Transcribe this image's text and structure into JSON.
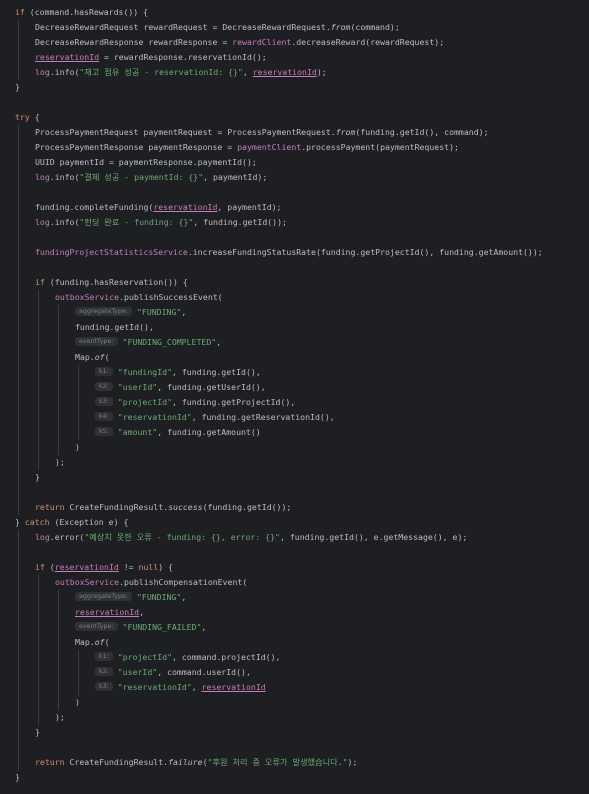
{
  "code": {
    "lines": [
      {
        "indent": 0,
        "tokens": [
          {
            "t": "if",
            "c": "kw"
          },
          {
            "t": " (command.hasRewards()) {"
          }
        ]
      },
      {
        "indent": 1,
        "tokens": [
          {
            "t": "DecreaseRewardRequest rewardRequest = DecreaseRewardRequest."
          },
          {
            "t": "from",
            "c": "it"
          },
          {
            "t": "(command);"
          }
        ]
      },
      {
        "indent": 1,
        "tokens": [
          {
            "t": "DecreaseRewardResponse rewardResponse = "
          },
          {
            "t": "rewardClient",
            "c": "fld"
          },
          {
            "t": ".decreaseReward(rewardRequest);"
          }
        ]
      },
      {
        "indent": 1,
        "tokens": [
          {
            "t": "reservationId",
            "c": "fld u"
          },
          {
            "t": " = rewardResponse.reservationId();"
          }
        ]
      },
      {
        "indent": 1,
        "tokens": [
          {
            "t": "log",
            "c": "fld"
          },
          {
            "t": ".info("
          },
          {
            "t": "\"재고 점유 성공 - reservationId: {}\"",
            "c": "str"
          },
          {
            "t": ", "
          },
          {
            "t": "reservationId",
            "c": "fld u"
          },
          {
            "t": ");"
          }
        ]
      },
      {
        "indent": 0,
        "tokens": [
          {
            "t": "}"
          }
        ]
      },
      {
        "indent": 0,
        "tokens": []
      },
      {
        "indent": 0,
        "tokens": [
          {
            "t": "try",
            "c": "kw"
          },
          {
            "t": " {"
          }
        ]
      },
      {
        "indent": 1,
        "tokens": [
          {
            "t": "ProcessPaymentRequest paymentRequest = ProcessPaymentRequest."
          },
          {
            "t": "from",
            "c": "it"
          },
          {
            "t": "(funding.getId(), command);"
          }
        ]
      },
      {
        "indent": 1,
        "tokens": [
          {
            "t": "ProcessPaymentResponse paymentResponse = "
          },
          {
            "t": "paymentClient",
            "c": "fld"
          },
          {
            "t": ".processPayment(paymentRequest);"
          }
        ]
      },
      {
        "indent": 1,
        "tokens": [
          {
            "t": "UUID paymentId = paymentResponse.paymentId();"
          }
        ]
      },
      {
        "indent": 1,
        "tokens": [
          {
            "t": "log",
            "c": "fld"
          },
          {
            "t": ".info("
          },
          {
            "t": "\"결제 성공 - paymentId: {}\"",
            "c": "str"
          },
          {
            "t": ", paymentId);"
          }
        ]
      },
      {
        "indent": 0,
        "tokens": []
      },
      {
        "indent": 1,
        "tokens": [
          {
            "t": "funding.completeFunding("
          },
          {
            "t": "reservationId",
            "c": "fld u"
          },
          {
            "t": ", paymentId);"
          }
        ]
      },
      {
        "indent": 1,
        "tokens": [
          {
            "t": "log",
            "c": "fld"
          },
          {
            "t": ".info("
          },
          {
            "t": "\"펀딩 완료 - funding: {}\"",
            "c": "str"
          },
          {
            "t": ", funding.getId());"
          }
        ]
      },
      {
        "indent": 0,
        "tokens": []
      },
      {
        "indent": 1,
        "tokens": [
          {
            "t": "fundingProjectStatisticsService",
            "c": "fld"
          },
          {
            "t": ".increaseFundingStatusRate(funding.getProjectId(), funding.getAmount());"
          }
        ]
      },
      {
        "indent": 0,
        "tokens": []
      },
      {
        "indent": 1,
        "tokens": [
          {
            "t": "if",
            "c": "kw"
          },
          {
            "t": " (funding.hasReservation()) {"
          }
        ]
      },
      {
        "indent": 2,
        "tokens": [
          {
            "t": "outboxService",
            "c": "fld"
          },
          {
            "t": ".publishSuccessEvent("
          }
        ]
      },
      {
        "indent": 3,
        "tokens": [
          {
            "t": "aggregateType:",
            "c": "hint"
          },
          {
            "t": "\"FUNDING\"",
            "c": "str"
          },
          {
            "t": ","
          }
        ]
      },
      {
        "indent": 3,
        "tokens": [
          {
            "t": "funding.getId(),"
          }
        ]
      },
      {
        "indent": 3,
        "tokens": [
          {
            "t": "eventType:",
            "c": "hint"
          },
          {
            "t": "\"FUNDING_COMPLETED\"",
            "c": "str"
          },
          {
            "t": ","
          }
        ]
      },
      {
        "indent": 3,
        "tokens": [
          {
            "t": "Map."
          },
          {
            "t": "of",
            "c": "it"
          },
          {
            "t": "("
          }
        ]
      },
      {
        "indent": 4,
        "tokens": [
          {
            "t": "k1:",
            "c": "hint"
          },
          {
            "t": "\"fundingId\"",
            "c": "str"
          },
          {
            "t": ", funding.getId(),"
          }
        ]
      },
      {
        "indent": 4,
        "tokens": [
          {
            "t": "k2:",
            "c": "hint"
          },
          {
            "t": "\"userId\"",
            "c": "str"
          },
          {
            "t": ", funding.getUserId(),"
          }
        ]
      },
      {
        "indent": 4,
        "tokens": [
          {
            "t": "k3:",
            "c": "hint"
          },
          {
            "t": "\"projectId\"",
            "c": "str"
          },
          {
            "t": ", funding.getProjectId(),"
          }
        ]
      },
      {
        "indent": 4,
        "tokens": [
          {
            "t": "k4:",
            "c": "hint"
          },
          {
            "t": "\"reservationId\"",
            "c": "str"
          },
          {
            "t": ", funding.getReservationId(),"
          }
        ]
      },
      {
        "indent": 4,
        "tokens": [
          {
            "t": "k5:",
            "c": "hint"
          },
          {
            "t": "\"amount\"",
            "c": "str"
          },
          {
            "t": ", funding.getAmount()"
          }
        ]
      },
      {
        "indent": 3,
        "tokens": [
          {
            "t": ")"
          }
        ]
      },
      {
        "indent": 2,
        "tokens": [
          {
            "t": ");"
          }
        ]
      },
      {
        "indent": 1,
        "tokens": [
          {
            "t": "}"
          }
        ]
      },
      {
        "indent": 0,
        "tokens": []
      },
      {
        "indent": 1,
        "tokens": [
          {
            "t": "return",
            "c": "kw"
          },
          {
            "t": " CreateFundingResult."
          },
          {
            "t": "success",
            "c": "it"
          },
          {
            "t": "(funding.getId());"
          }
        ]
      },
      {
        "indent": 0,
        "tokens": [
          {
            "t": "} "
          },
          {
            "t": "catch",
            "c": "kw"
          },
          {
            "t": " (Exception e) {"
          }
        ]
      },
      {
        "indent": 1,
        "tokens": [
          {
            "t": "log",
            "c": "fld"
          },
          {
            "t": ".error("
          },
          {
            "t": "\"예상치 못한 오류 - funding: {}, error: {}\"",
            "c": "str"
          },
          {
            "t": ", funding.getId(), e.getMessage(), e);"
          }
        ]
      },
      {
        "indent": 0,
        "tokens": []
      },
      {
        "indent": 1,
        "tokens": [
          {
            "t": "if",
            "c": "kw"
          },
          {
            "t": " ("
          },
          {
            "t": "reservationId",
            "c": "fld u"
          },
          {
            "t": " != "
          },
          {
            "t": "null",
            "c": "kw"
          },
          {
            "t": ") {"
          }
        ]
      },
      {
        "indent": 2,
        "tokens": [
          {
            "t": "outboxService",
            "c": "fld"
          },
          {
            "t": ".publishCompensationEvent("
          }
        ]
      },
      {
        "indent": 3,
        "tokens": [
          {
            "t": "aggregateType:",
            "c": "hint"
          },
          {
            "t": "\"FUNDING\"",
            "c": "str"
          },
          {
            "t": ","
          }
        ]
      },
      {
        "indent": 3,
        "tokens": [
          {
            "t": "reservationId",
            "c": "fld u"
          },
          {
            "t": ","
          }
        ]
      },
      {
        "indent": 3,
        "tokens": [
          {
            "t": "eventType:",
            "c": "hint"
          },
          {
            "t": "\"FUNDING_FAILED\"",
            "c": "str"
          },
          {
            "t": ","
          }
        ]
      },
      {
        "indent": 3,
        "tokens": [
          {
            "t": "Map."
          },
          {
            "t": "of",
            "c": "it"
          },
          {
            "t": "("
          }
        ]
      },
      {
        "indent": 4,
        "tokens": [
          {
            "t": "k1:",
            "c": "hint"
          },
          {
            "t": "\"projectId\"",
            "c": "str"
          },
          {
            "t": ", command.projectId(),"
          }
        ]
      },
      {
        "indent": 4,
        "tokens": [
          {
            "t": "k2:",
            "c": "hint"
          },
          {
            "t": "\"userId\"",
            "c": "str"
          },
          {
            "t": ", command.userId(),"
          }
        ]
      },
      {
        "indent": 4,
        "tokens": [
          {
            "t": "k3:",
            "c": "hint"
          },
          {
            "t": "\"reservationId\"",
            "c": "str"
          },
          {
            "t": ", "
          },
          {
            "t": "reservationId",
            "c": "fld u"
          }
        ]
      },
      {
        "indent": 3,
        "tokens": [
          {
            "t": ")"
          }
        ]
      },
      {
        "indent": 2,
        "tokens": [
          {
            "t": ");"
          }
        ]
      },
      {
        "indent": 1,
        "tokens": [
          {
            "t": "}"
          }
        ]
      },
      {
        "indent": 0,
        "tokens": []
      },
      {
        "indent": 1,
        "tokens": [
          {
            "t": "return",
            "c": "kw"
          },
          {
            "t": " CreateFundingResult."
          },
          {
            "t": "failure",
            "c": "it"
          },
          {
            "t": "("
          },
          {
            "t": "\"후원 처리 중 오류가 발생했습니다.\"",
            "c": "str"
          },
          {
            "t": ");"
          }
        ]
      },
      {
        "indent": 0,
        "tokens": [
          {
            "t": "}"
          }
        ]
      }
    ]
  },
  "colors": {
    "background": "#1e1f22",
    "text": "#bcbec4",
    "keyword": "#cf8e6d",
    "string": "#6aab73",
    "field": "#c77dbb",
    "hint_bg": "#2f3134",
    "hint_text": "#7a7e85",
    "indent_guide": "#393b40"
  }
}
